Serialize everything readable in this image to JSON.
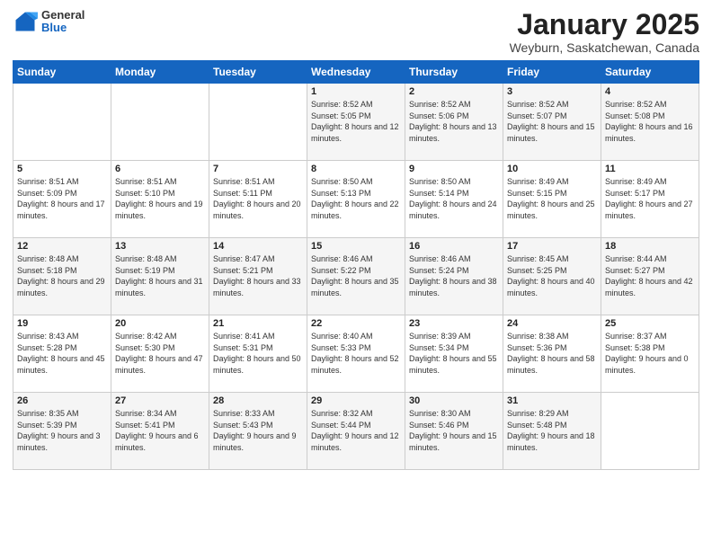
{
  "logo": {
    "general": "General",
    "blue": "Blue"
  },
  "header": {
    "month_year": "January 2025",
    "location": "Weyburn, Saskatchewan, Canada"
  },
  "weekdays": [
    "Sunday",
    "Monday",
    "Tuesday",
    "Wednesday",
    "Thursday",
    "Friday",
    "Saturday"
  ],
  "weeks": [
    [
      {
        "day": "",
        "info": ""
      },
      {
        "day": "",
        "info": ""
      },
      {
        "day": "",
        "info": ""
      },
      {
        "day": "1",
        "info": "Sunrise: 8:52 AM\nSunset: 5:05 PM\nDaylight: 8 hours\nand 12 minutes."
      },
      {
        "day": "2",
        "info": "Sunrise: 8:52 AM\nSunset: 5:06 PM\nDaylight: 8 hours\nand 13 minutes."
      },
      {
        "day": "3",
        "info": "Sunrise: 8:52 AM\nSunset: 5:07 PM\nDaylight: 8 hours\nand 15 minutes."
      },
      {
        "day": "4",
        "info": "Sunrise: 8:52 AM\nSunset: 5:08 PM\nDaylight: 8 hours\nand 16 minutes."
      }
    ],
    [
      {
        "day": "5",
        "info": "Sunrise: 8:51 AM\nSunset: 5:09 PM\nDaylight: 8 hours\nand 17 minutes."
      },
      {
        "day": "6",
        "info": "Sunrise: 8:51 AM\nSunset: 5:10 PM\nDaylight: 8 hours\nand 19 minutes."
      },
      {
        "day": "7",
        "info": "Sunrise: 8:51 AM\nSunset: 5:11 PM\nDaylight: 8 hours\nand 20 minutes."
      },
      {
        "day": "8",
        "info": "Sunrise: 8:50 AM\nSunset: 5:13 PM\nDaylight: 8 hours\nand 22 minutes."
      },
      {
        "day": "9",
        "info": "Sunrise: 8:50 AM\nSunset: 5:14 PM\nDaylight: 8 hours\nand 24 minutes."
      },
      {
        "day": "10",
        "info": "Sunrise: 8:49 AM\nSunset: 5:15 PM\nDaylight: 8 hours\nand 25 minutes."
      },
      {
        "day": "11",
        "info": "Sunrise: 8:49 AM\nSunset: 5:17 PM\nDaylight: 8 hours\nand 27 minutes."
      }
    ],
    [
      {
        "day": "12",
        "info": "Sunrise: 8:48 AM\nSunset: 5:18 PM\nDaylight: 8 hours\nand 29 minutes."
      },
      {
        "day": "13",
        "info": "Sunrise: 8:48 AM\nSunset: 5:19 PM\nDaylight: 8 hours\nand 31 minutes."
      },
      {
        "day": "14",
        "info": "Sunrise: 8:47 AM\nSunset: 5:21 PM\nDaylight: 8 hours\nand 33 minutes."
      },
      {
        "day": "15",
        "info": "Sunrise: 8:46 AM\nSunset: 5:22 PM\nDaylight: 8 hours\nand 35 minutes."
      },
      {
        "day": "16",
        "info": "Sunrise: 8:46 AM\nSunset: 5:24 PM\nDaylight: 8 hours\nand 38 minutes."
      },
      {
        "day": "17",
        "info": "Sunrise: 8:45 AM\nSunset: 5:25 PM\nDaylight: 8 hours\nand 40 minutes."
      },
      {
        "day": "18",
        "info": "Sunrise: 8:44 AM\nSunset: 5:27 PM\nDaylight: 8 hours\nand 42 minutes."
      }
    ],
    [
      {
        "day": "19",
        "info": "Sunrise: 8:43 AM\nSunset: 5:28 PM\nDaylight: 8 hours\nand 45 minutes."
      },
      {
        "day": "20",
        "info": "Sunrise: 8:42 AM\nSunset: 5:30 PM\nDaylight: 8 hours\nand 47 minutes."
      },
      {
        "day": "21",
        "info": "Sunrise: 8:41 AM\nSunset: 5:31 PM\nDaylight: 8 hours\nand 50 minutes."
      },
      {
        "day": "22",
        "info": "Sunrise: 8:40 AM\nSunset: 5:33 PM\nDaylight: 8 hours\nand 52 minutes."
      },
      {
        "day": "23",
        "info": "Sunrise: 8:39 AM\nSunset: 5:34 PM\nDaylight: 8 hours\nand 55 minutes."
      },
      {
        "day": "24",
        "info": "Sunrise: 8:38 AM\nSunset: 5:36 PM\nDaylight: 8 hours\nand 58 minutes."
      },
      {
        "day": "25",
        "info": "Sunrise: 8:37 AM\nSunset: 5:38 PM\nDaylight: 9 hours\nand 0 minutes."
      }
    ],
    [
      {
        "day": "26",
        "info": "Sunrise: 8:35 AM\nSunset: 5:39 PM\nDaylight: 9 hours\nand 3 minutes."
      },
      {
        "day": "27",
        "info": "Sunrise: 8:34 AM\nSunset: 5:41 PM\nDaylight: 9 hours\nand 6 minutes."
      },
      {
        "day": "28",
        "info": "Sunrise: 8:33 AM\nSunset: 5:43 PM\nDaylight: 9 hours\nand 9 minutes."
      },
      {
        "day": "29",
        "info": "Sunrise: 8:32 AM\nSunset: 5:44 PM\nDaylight: 9 hours\nand 12 minutes."
      },
      {
        "day": "30",
        "info": "Sunrise: 8:30 AM\nSunset: 5:46 PM\nDaylight: 9 hours\nand 15 minutes."
      },
      {
        "day": "31",
        "info": "Sunrise: 8:29 AM\nSunset: 5:48 PM\nDaylight: 9 hours\nand 18 minutes."
      },
      {
        "day": "",
        "info": ""
      }
    ]
  ]
}
